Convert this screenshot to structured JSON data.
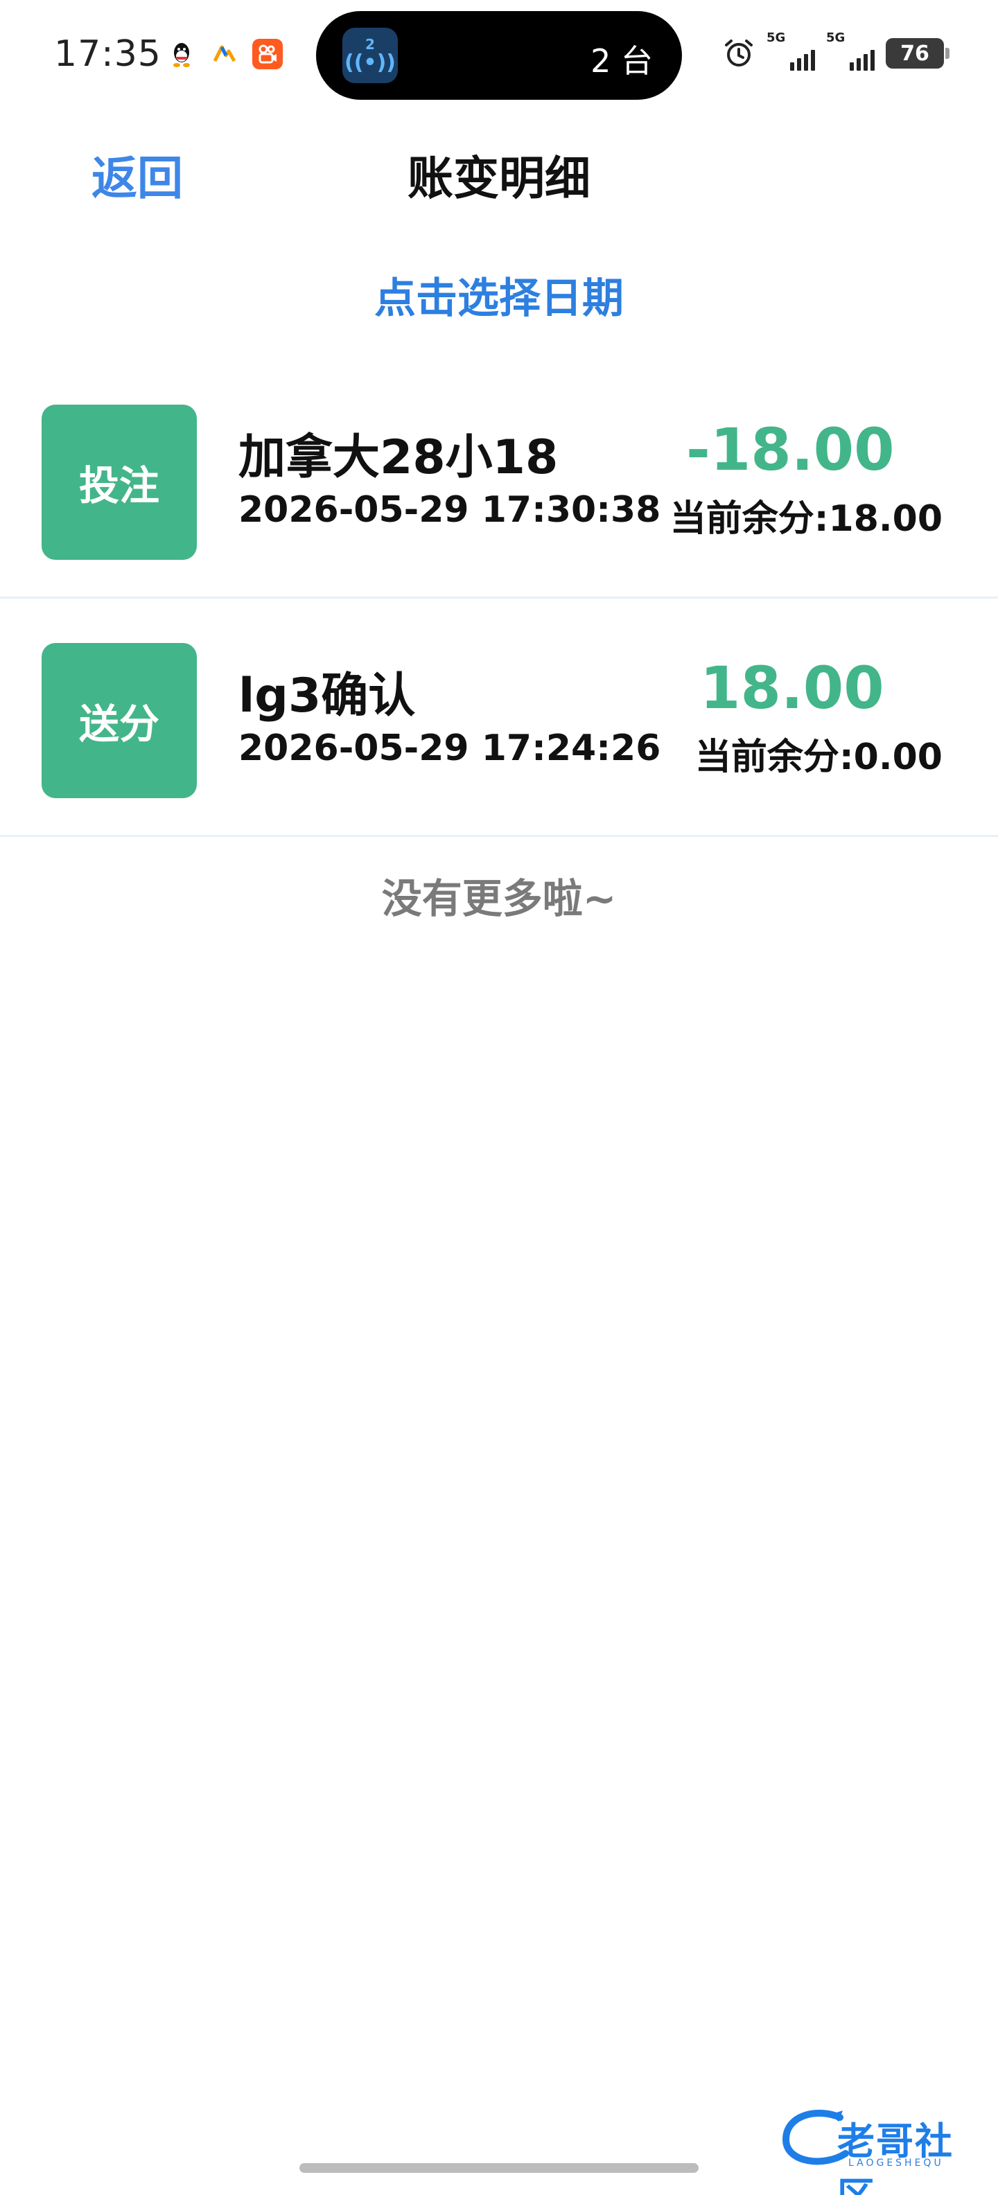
{
  "status_bar": {
    "time": "17:35",
    "island_badge": "2",
    "island_text": "2 台",
    "signal_1_label": "5G",
    "signal_2_label": "5G",
    "battery": "76"
  },
  "header": {
    "back_label": "返回",
    "title": "账变明细"
  },
  "date_picker": {
    "label": "点击选择日期"
  },
  "records": [
    {
      "badge": "投注",
      "title": "加拿大28小18",
      "time": "2026-05-29 17:30:38",
      "amount": "-18.00",
      "balance": "当前余分:18.00"
    },
    {
      "badge": "送分",
      "title": "lg3确认",
      "time": "2026-05-29 17:24:26",
      "amount": "18.00",
      "balance": "当前余分:0.00"
    }
  ],
  "footer": {
    "no_more": "没有更多啦~"
  },
  "watermark": {
    "text": "老哥社区",
    "sub": "LAOGESHEQU"
  },
  "colors": {
    "accent_blue": "#3e86e8",
    "badge_green": "#43b58a",
    "amount_green": "#43b58a"
  }
}
